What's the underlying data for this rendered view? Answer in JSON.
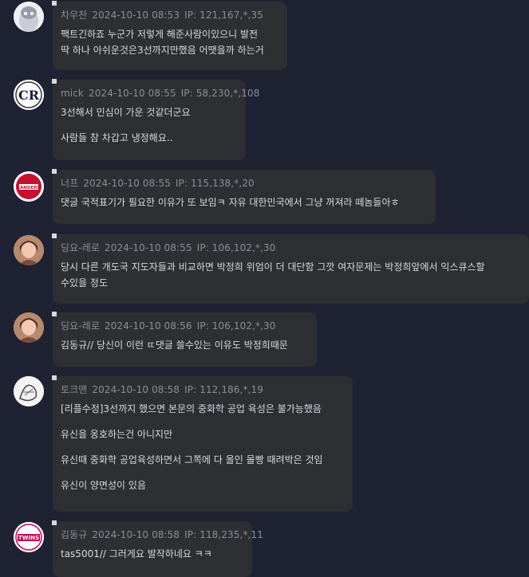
{
  "comments": [
    {
      "author": "차우찬",
      "date": "2024-10-10 08:53",
      "ip": "IP: 121,167,*,35",
      "avatar_icon": "mascot-character-icon",
      "paragraphs": [
        "팩트긴하죠 누군가 저렇게 해준사람이있으니 발전\n딱 하나 아쉬운것은3선까지만했음 어땟을까 하는거"
      ]
    },
    {
      "author": "mick",
      "date": "2024-10-10 08:55",
      "ip": "IP: 58,230,*,108",
      "avatar_icon": "rockies-logo-icon",
      "paragraphs": [
        "3선해서 민심이 가운 것같더군요",
        "사람들 참 차갑고 냉정해요.."
      ]
    },
    {
      "author": "너프",
      "date": "2024-10-10 08:55",
      "ip": "IP: 115,138,*,20",
      "avatar_icon": "landers-logo-icon",
      "paragraphs": [
        "댓글 국적표기가 필요한 이유가 또 보임ㅋ 자유 대한민국에서 그냥 꺼져라 떼놈들아ㅎ"
      ]
    },
    {
      "author": "딩요-레로",
      "date": "2024-10-10 08:55",
      "ip": "IP: 106,102,*,30",
      "avatar_icon": "user-photo-icon",
      "paragraphs": [
        "당시 다른 개도국 지도자들과 비교하면 박정희 위엄이 더 대단함 그깟 여자문제는 박정희앞에서 익스큐스할\n수있을 정도"
      ]
    },
    {
      "author": "딩요-레로",
      "date": "2024-10-10 08:56",
      "ip": "IP: 106,102,*,30",
      "avatar_icon": "user-photo-icon",
      "paragraphs": [
        "김동규// 당신이 이런 ㄸ댓글 쓸수있는 이유도 박정희때문"
      ]
    },
    {
      "author": "토크맨",
      "date": "2024-10-10 08:58",
      "ip": "IP: 112,186,*,19",
      "avatar_icon": "sketch-drawing-icon",
      "paragraphs": [
        "[리플수정]3선까지 했으면 본문의 중화학 공업 육성은 불가능했음",
        "유신을 옹호하는건 아니지만",
        "유신때 중화학 공업육성하면서 그쪽에 다 올인 몰빵 때려박은 것임",
        "유신이 양면성이 있음"
      ]
    },
    {
      "author": "김동규",
      "date": "2024-10-10 08:58",
      "ip": "IP: 118,235,*,11",
      "avatar_icon": "twins-logo-icon",
      "paragraphs": [
        "tas5001// 그러게요 발작하네요 ㅋㅋ"
      ]
    }
  ]
}
